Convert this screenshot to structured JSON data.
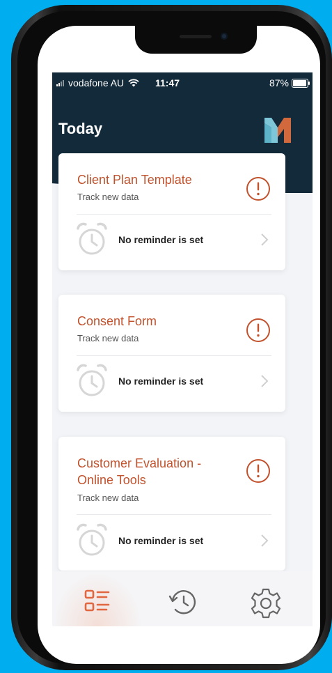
{
  "status_bar": {
    "carrier": "vodafone AU",
    "time": "11:47",
    "battery": "87%"
  },
  "header": {
    "title": "Today"
  },
  "cards": [
    {
      "title": "Client Plan Template",
      "subtitle": "Track new data",
      "reminder": "No reminder is set"
    },
    {
      "title": "Consent Form",
      "subtitle": "Track new data",
      "reminder": "No reminder is set"
    },
    {
      "title": "Customer Evaluation - Online Tools",
      "subtitle": "Track new data",
      "reminder": "No reminder is set"
    }
  ],
  "tabbar": {
    "tabs": [
      {
        "icon": "list-icon",
        "active": true
      },
      {
        "icon": "history-icon",
        "active": false
      },
      {
        "icon": "settings-gear-icon",
        "active": false
      }
    ]
  },
  "colors": {
    "header": "#132a3a",
    "accent": "#c0522d",
    "background": "#f2f4f8",
    "frame": "#00aeef"
  }
}
